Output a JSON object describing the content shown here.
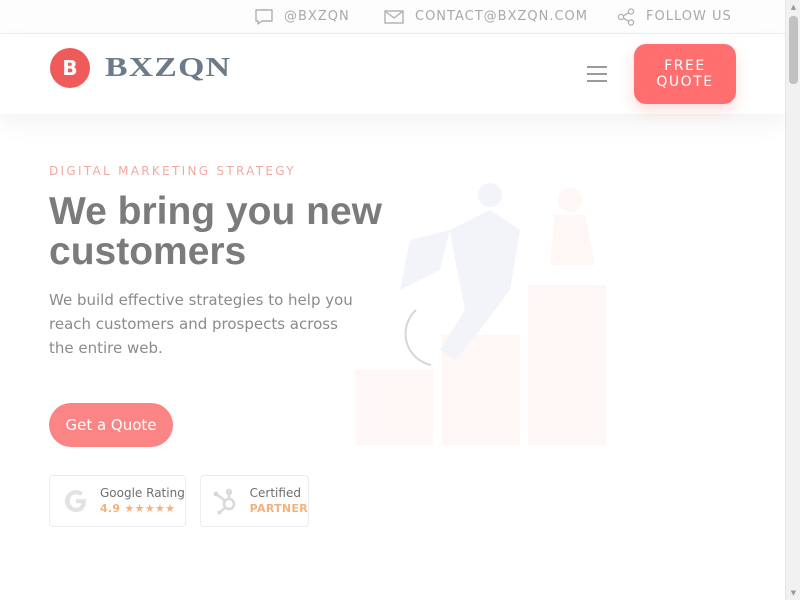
{
  "topbar": {
    "social_handle": "@BXZQN",
    "email": "CONTACT@BXZQN.COM",
    "follow": "FOLLOW US"
  },
  "header": {
    "logo_mark": "B",
    "logo_text": "BXZQN",
    "quote_line1": "FREE",
    "quote_line2": "QUOTE"
  },
  "hero": {
    "eyebrow": "DIGITAL MARKETING STRATEGY",
    "headline": "We bring you new customers",
    "subtext": "We build effective strategies to help you reach customers and prospects across the entire web.",
    "cta": "Get a Quote"
  },
  "badges": [
    {
      "title": "Google Rating",
      "detail": "4.9 ★★★★★"
    },
    {
      "title": "Certified",
      "detail": "PARTNER"
    }
  ],
  "colors": {
    "accent": "#ff6f6f",
    "eyebrow": "#f2a9a0",
    "badge_highlight": "#f4b27b",
    "logo_text": "#6b7b8a"
  },
  "icons": [
    "chat-icon",
    "mail-icon",
    "share-icon",
    "menu-icon",
    "google-icon",
    "hubspot-icon"
  ]
}
